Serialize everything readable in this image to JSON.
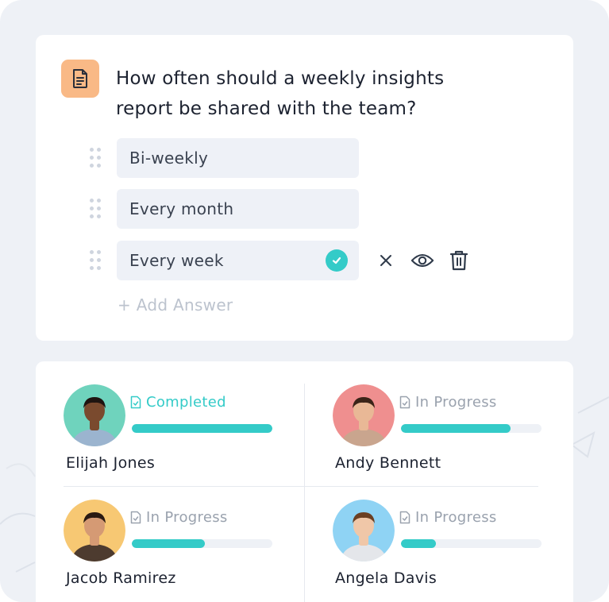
{
  "question": {
    "icon": "document-icon",
    "text": "How often should a weekly insights report be shared with the team?"
  },
  "answers": [
    {
      "label": "Bi-weekly",
      "selected": false
    },
    {
      "label": "Every month",
      "selected": false
    },
    {
      "label": "Every week",
      "selected": true
    }
  ],
  "row_actions": [
    "close-icon",
    "eye-icon",
    "trash-icon"
  ],
  "add_answer_label": "+ Add Answer",
  "members": [
    {
      "name": "Elijah Jones",
      "status": "Completed",
      "progress": 1.0,
      "avatar_bg": "#6fd3bd",
      "skin": "#7a4a2e",
      "hair": "#1e1410",
      "shirt": "#9bb4cf"
    },
    {
      "name": "Andy Bennett",
      "status": "In Progress",
      "progress": 0.78,
      "avatar_bg": "#ef8f8f",
      "skin": "#e9b896",
      "hair": "#3b2418",
      "shirt": "#c9a58e"
    },
    {
      "name": "Jacob Ramirez",
      "status": "In Progress",
      "progress": 0.52,
      "avatar_bg": "#f7c873",
      "skin": "#d59a74",
      "hair": "#2a1a12",
      "shirt": "#4d3b2f"
    },
    {
      "name": "Angela Davis",
      "status": "In Progress",
      "progress": 0.25,
      "avatar_bg": "#8fd3f4",
      "skin": "#f0c7a8",
      "hair": "#6b3f22",
      "shirt": "#e4e6ea"
    }
  ],
  "colors": {
    "accent": "#34cbc8",
    "badge": "#f9b986",
    "muted": "#9aa2ae"
  }
}
